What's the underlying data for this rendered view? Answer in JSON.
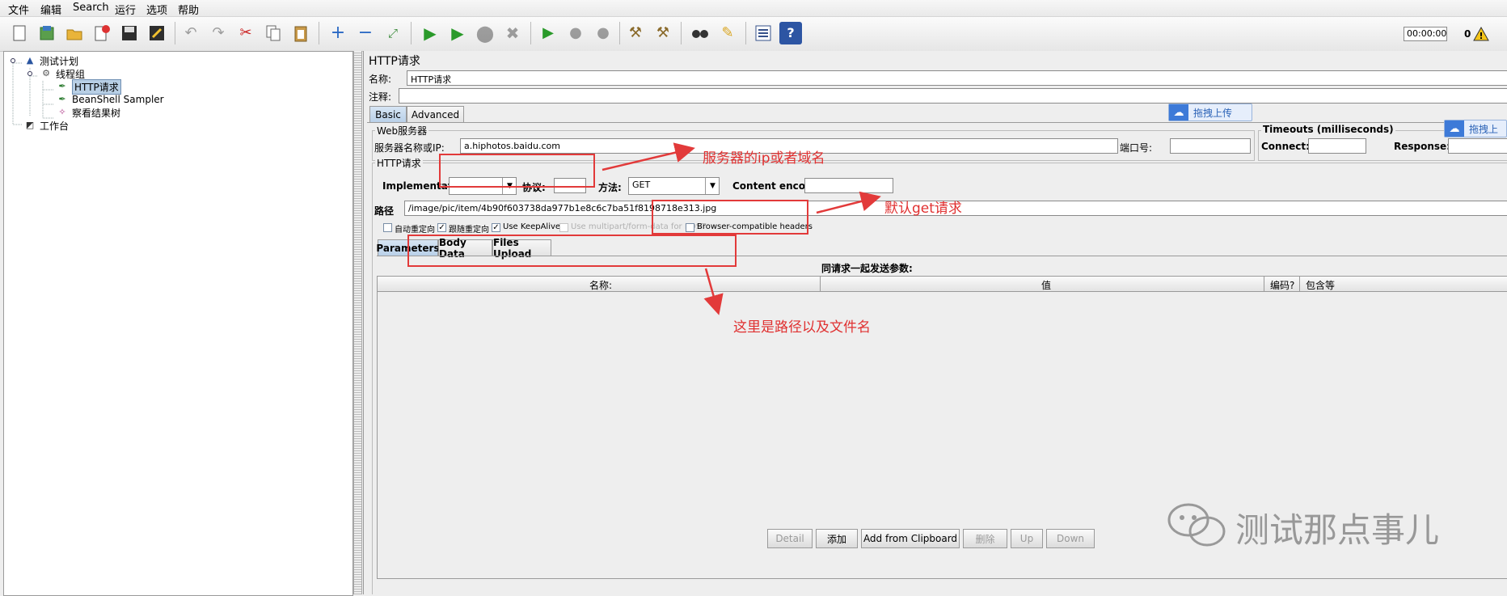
{
  "menu": [
    "文件",
    "编辑",
    "Search",
    "运行",
    "选项",
    "帮助"
  ],
  "toolbar": {
    "timer": "00:00:00",
    "warn_count": "0"
  },
  "tree": {
    "items": [
      {
        "label": "测试计划"
      },
      {
        "label": "线程组"
      },
      {
        "label": "HTTP请求"
      },
      {
        "label": "BeanShell Sampler"
      },
      {
        "label": "察看结果树"
      },
      {
        "label": "工作台"
      }
    ]
  },
  "panel": {
    "title": "HTTP请求",
    "name_label": "名称:",
    "name_value": "HTTP请求",
    "comment_label": "注释:",
    "tabs": [
      "Basic",
      "Advanced"
    ],
    "web_server": {
      "legend": "Web服务器",
      "server_label": "服务器名称或IP:",
      "server_value": "a.hiphotos.baidu.com",
      "port_label": "端口号:",
      "port_value": ""
    },
    "timeouts": {
      "legend": "Timeouts (milliseconds)",
      "connect_label": "Connect:",
      "response_label": "Response:"
    },
    "http": {
      "legend": "HTTP请求",
      "impl_label": "Implementation:",
      "impl_value": "",
      "protocol_label": "协议:",
      "method_label": "方法:",
      "method_value": "GET",
      "encoding_label": "Content encoding:",
      "path_label": "路径",
      "path_value": "/image/pic/item/4b90f603738da977b1e8c6c7ba51f8198718e313.jpg"
    },
    "checkboxes": [
      {
        "label": "自动重定向",
        "checked": false,
        "disabled": false
      },
      {
        "label": "跟随重定向",
        "checked": true,
        "disabled": false
      },
      {
        "label": "Use KeepAlive",
        "checked": true,
        "disabled": false
      },
      {
        "label": "Use multipart/form-data for POST",
        "checked": false,
        "disabled": true
      },
      {
        "label": "Browser-compatible headers",
        "checked": false,
        "disabled": false
      }
    ],
    "subtabs": [
      "Parameters",
      "Body Data",
      "Files Upload"
    ],
    "params_caption": "同请求一起发送参数:",
    "table_headers": [
      "名称:",
      "值",
      "编码?",
      "包含等"
    ],
    "buttons": [
      {
        "label": "Detail",
        "disabled": true
      },
      {
        "label": "添加",
        "disabled": false
      },
      {
        "label": "Add from Clipboard",
        "disabled": false
      },
      {
        "label": "删除",
        "disabled": true
      },
      {
        "label": "Up",
        "disabled": true
      },
      {
        "label": "Down",
        "disabled": true
      }
    ]
  },
  "overlays": {
    "upload_label": "拖拽上传",
    "upload_label_2": "拖拽上",
    "annotation_server": "服务器的ip或者域名",
    "annotation_method": "默认get请求",
    "annotation_path": "这里是路径以及文件名",
    "watermark": "测试那点事儿"
  },
  "colors": {
    "annotation": "#e23a3a",
    "selection": "#b8cfe5"
  }
}
